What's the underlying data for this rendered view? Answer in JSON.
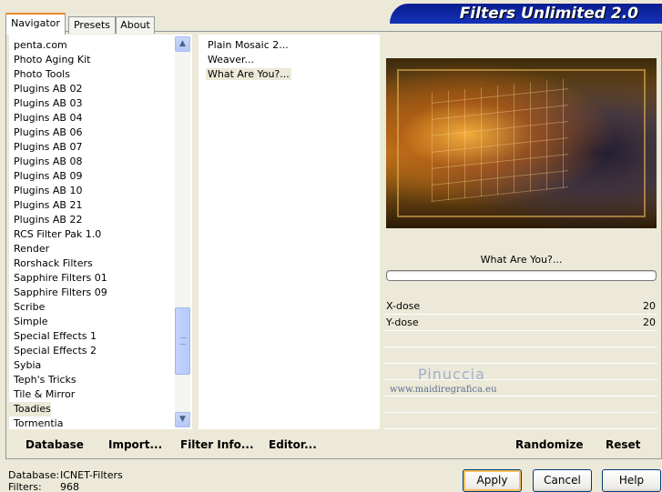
{
  "header": {
    "title": "Filters Unlimited 2.0"
  },
  "tabs": [
    {
      "label": "Navigator",
      "active": true
    },
    {
      "label": "Presets",
      "active": false
    },
    {
      "label": "About",
      "active": false
    }
  ],
  "categories": [
    "penta.com",
    "Photo Aging Kit",
    "Photo Tools",
    "Plugins AB 02",
    "Plugins AB 03",
    "Plugins AB 04",
    "Plugins AB 06",
    "Plugins AB 07",
    "Plugins AB 08",
    "Plugins AB 09",
    "Plugins AB 10",
    "Plugins AB 21",
    "Plugins AB 22",
    "RCS Filter Pak 1.0",
    "Render",
    "Rorshack Filters",
    "Sapphire Filters 01",
    "Sapphire Filters 09",
    "Scribe",
    "Simple",
    "Special Effects 1",
    "Special Effects 2",
    "Sybia",
    "Teph's Tricks",
    "Tile & Mirror",
    "Toadies",
    "Tormentia"
  ],
  "selected_category": "Toadies",
  "filters": [
    "Plain Mosaic 2...",
    "Weaver...",
    "What Are You?..."
  ],
  "selected_filter": "What Are You?...",
  "filter_name_display": "What Are You?...",
  "params": [
    {
      "name": "X-dose",
      "value": "20"
    },
    {
      "name": "Y-dose",
      "value": "20"
    }
  ],
  "watermark": {
    "name": "Pinuccia",
    "site": "www.maidiregrafica.eu"
  },
  "left_buttons": {
    "database": "Database",
    "import": "Import...",
    "filter_info": "Filter Info...",
    "editor": "Editor..."
  },
  "right_buttons": {
    "randomize": "Randomize",
    "reset": "Reset"
  },
  "status": {
    "database_label": "Database:",
    "database_value": "ICNET-Filters",
    "filters_label": "Filters:",
    "filters_value": "968"
  },
  "dialog_buttons": {
    "apply": "Apply",
    "cancel": "Cancel",
    "help": "Help"
  },
  "icons": {
    "scroll_up": "chevron-up-icon",
    "scroll_down": "chevron-down-icon"
  }
}
